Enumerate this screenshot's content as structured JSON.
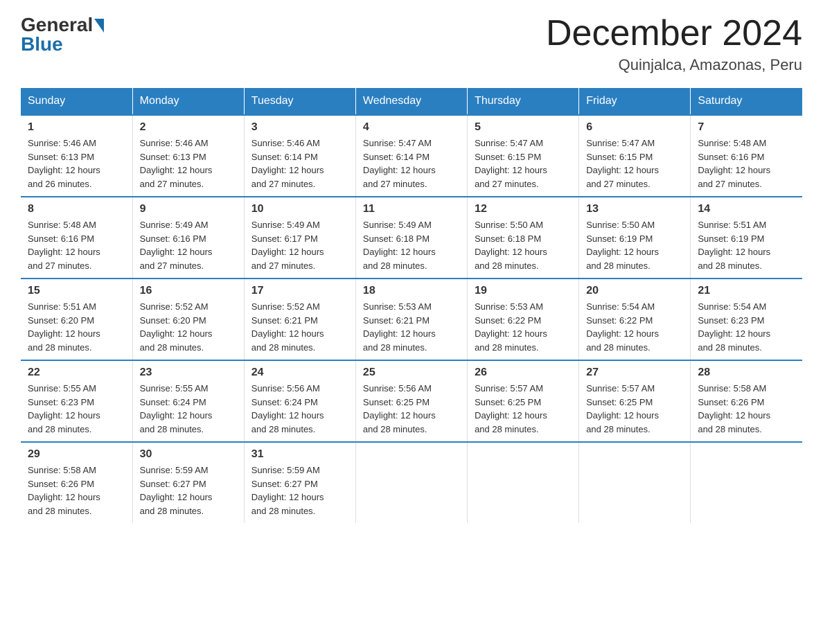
{
  "logo": {
    "general": "General",
    "blue": "Blue"
  },
  "title": "December 2024",
  "location": "Quinjalca, Amazonas, Peru",
  "days_of_week": [
    "Sunday",
    "Monday",
    "Tuesday",
    "Wednesday",
    "Thursday",
    "Friday",
    "Saturday"
  ],
  "weeks": [
    [
      {
        "day": "1",
        "sunrise": "5:46 AM",
        "sunset": "6:13 PM",
        "daylight": "12 hours and 26 minutes."
      },
      {
        "day": "2",
        "sunrise": "5:46 AM",
        "sunset": "6:13 PM",
        "daylight": "12 hours and 27 minutes."
      },
      {
        "day": "3",
        "sunrise": "5:46 AM",
        "sunset": "6:14 PM",
        "daylight": "12 hours and 27 minutes."
      },
      {
        "day": "4",
        "sunrise": "5:47 AM",
        "sunset": "6:14 PM",
        "daylight": "12 hours and 27 minutes."
      },
      {
        "day": "5",
        "sunrise": "5:47 AM",
        "sunset": "6:15 PM",
        "daylight": "12 hours and 27 minutes."
      },
      {
        "day": "6",
        "sunrise": "5:47 AM",
        "sunset": "6:15 PM",
        "daylight": "12 hours and 27 minutes."
      },
      {
        "day": "7",
        "sunrise": "5:48 AM",
        "sunset": "6:16 PM",
        "daylight": "12 hours and 27 minutes."
      }
    ],
    [
      {
        "day": "8",
        "sunrise": "5:48 AM",
        "sunset": "6:16 PM",
        "daylight": "12 hours and 27 minutes."
      },
      {
        "day": "9",
        "sunrise": "5:49 AM",
        "sunset": "6:16 PM",
        "daylight": "12 hours and 27 minutes."
      },
      {
        "day": "10",
        "sunrise": "5:49 AM",
        "sunset": "6:17 PM",
        "daylight": "12 hours and 27 minutes."
      },
      {
        "day": "11",
        "sunrise": "5:49 AM",
        "sunset": "6:18 PM",
        "daylight": "12 hours and 28 minutes."
      },
      {
        "day": "12",
        "sunrise": "5:50 AM",
        "sunset": "6:18 PM",
        "daylight": "12 hours and 28 minutes."
      },
      {
        "day": "13",
        "sunrise": "5:50 AM",
        "sunset": "6:19 PM",
        "daylight": "12 hours and 28 minutes."
      },
      {
        "day": "14",
        "sunrise": "5:51 AM",
        "sunset": "6:19 PM",
        "daylight": "12 hours and 28 minutes."
      }
    ],
    [
      {
        "day": "15",
        "sunrise": "5:51 AM",
        "sunset": "6:20 PM",
        "daylight": "12 hours and 28 minutes."
      },
      {
        "day": "16",
        "sunrise": "5:52 AM",
        "sunset": "6:20 PM",
        "daylight": "12 hours and 28 minutes."
      },
      {
        "day": "17",
        "sunrise": "5:52 AM",
        "sunset": "6:21 PM",
        "daylight": "12 hours and 28 minutes."
      },
      {
        "day": "18",
        "sunrise": "5:53 AM",
        "sunset": "6:21 PM",
        "daylight": "12 hours and 28 minutes."
      },
      {
        "day": "19",
        "sunrise": "5:53 AM",
        "sunset": "6:22 PM",
        "daylight": "12 hours and 28 minutes."
      },
      {
        "day": "20",
        "sunrise": "5:54 AM",
        "sunset": "6:22 PM",
        "daylight": "12 hours and 28 minutes."
      },
      {
        "day": "21",
        "sunrise": "5:54 AM",
        "sunset": "6:23 PM",
        "daylight": "12 hours and 28 minutes."
      }
    ],
    [
      {
        "day": "22",
        "sunrise": "5:55 AM",
        "sunset": "6:23 PM",
        "daylight": "12 hours and 28 minutes."
      },
      {
        "day": "23",
        "sunrise": "5:55 AM",
        "sunset": "6:24 PM",
        "daylight": "12 hours and 28 minutes."
      },
      {
        "day": "24",
        "sunrise": "5:56 AM",
        "sunset": "6:24 PM",
        "daylight": "12 hours and 28 minutes."
      },
      {
        "day": "25",
        "sunrise": "5:56 AM",
        "sunset": "6:25 PM",
        "daylight": "12 hours and 28 minutes."
      },
      {
        "day": "26",
        "sunrise": "5:57 AM",
        "sunset": "6:25 PM",
        "daylight": "12 hours and 28 minutes."
      },
      {
        "day": "27",
        "sunrise": "5:57 AM",
        "sunset": "6:25 PM",
        "daylight": "12 hours and 28 minutes."
      },
      {
        "day": "28",
        "sunrise": "5:58 AM",
        "sunset": "6:26 PM",
        "daylight": "12 hours and 28 minutes."
      }
    ],
    [
      {
        "day": "29",
        "sunrise": "5:58 AM",
        "sunset": "6:26 PM",
        "daylight": "12 hours and 28 minutes."
      },
      {
        "day": "30",
        "sunrise": "5:59 AM",
        "sunset": "6:27 PM",
        "daylight": "12 hours and 28 minutes."
      },
      {
        "day": "31",
        "sunrise": "5:59 AM",
        "sunset": "6:27 PM",
        "daylight": "12 hours and 28 minutes."
      },
      null,
      null,
      null,
      null
    ]
  ],
  "labels": {
    "sunrise": "Sunrise:",
    "sunset": "Sunset:",
    "daylight": "Daylight:"
  }
}
